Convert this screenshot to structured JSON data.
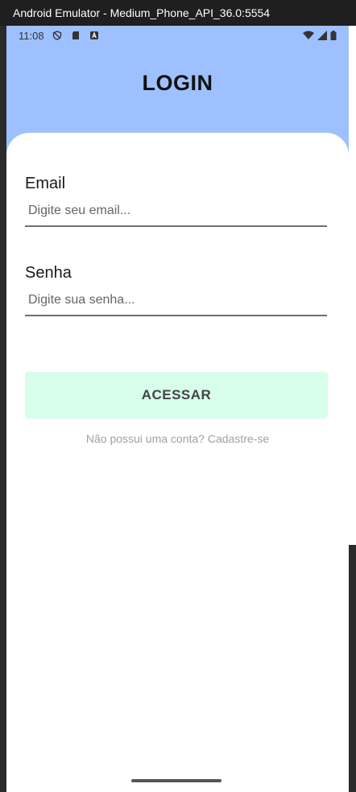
{
  "window": {
    "title": "Android Emulator - Medium_Phone_API_36.0:5554"
  },
  "status_bar": {
    "time": "11:08"
  },
  "screen": {
    "title": "LOGIN",
    "email": {
      "label": "Email",
      "placeholder": "Digite seu email...",
      "value": ""
    },
    "password": {
      "label": "Senha",
      "placeholder": "Digite sua senha...",
      "value": ""
    },
    "submit_label": "ACESSAR",
    "signup_text": "Não possui uma conta? Cadastre-se"
  },
  "colors": {
    "header": "#9fc0ff",
    "button": "#d7fdeb"
  }
}
